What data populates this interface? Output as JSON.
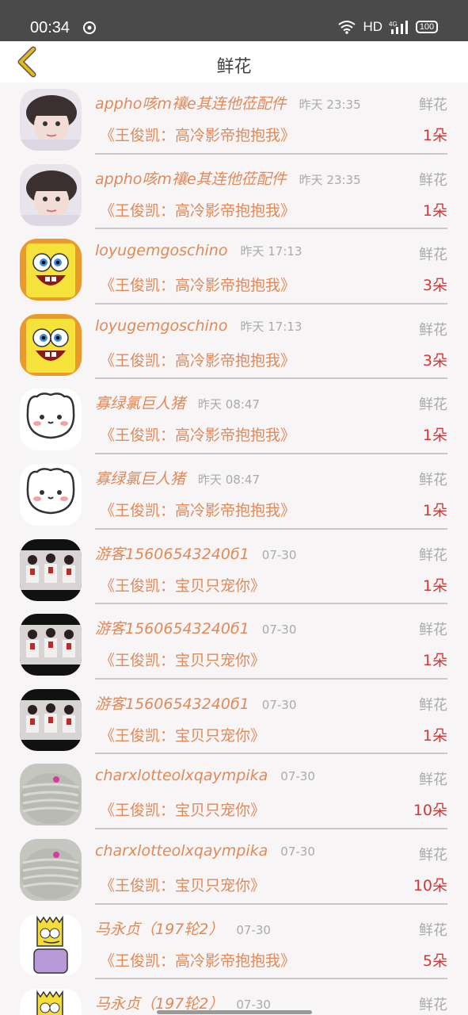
{
  "status": {
    "time": "00:34",
    "network": "HD",
    "signal": "4G",
    "battery": "100"
  },
  "header": {
    "title": "鲜花",
    "back_icon": "chevron-left-icon"
  },
  "colors": {
    "accent": "#e08a5a",
    "count": "#d23a3a",
    "nav_icon": "#e8b818"
  },
  "rows": [
    {
      "avatar": "photo-girl",
      "name": "appho咳m禳e其连他莅配件",
      "time": "昨天 23:35",
      "kind": "鲜花",
      "gift": "《王俊凯：高冷影帝抱抱我》",
      "count": "1朵"
    },
    {
      "avatar": "photo-girl",
      "name": "appho咳m禳e其连他莅配件",
      "time": "昨天 23:35",
      "kind": "鲜花",
      "gift": "《王俊凯：高冷影帝抱抱我》",
      "count": "1朵"
    },
    {
      "avatar": "spongebob",
      "name": "loyugemgoschino",
      "time": "昨天 17:13",
      "kind": "鲜花",
      "gift": "《王俊凯：高冷影帝抱抱我》",
      "count": "3朵"
    },
    {
      "avatar": "spongebob",
      "name": "loyugemgoschino",
      "time": "昨天 17:13",
      "kind": "鲜花",
      "gift": "《王俊凯：高冷影帝抱抱我》",
      "count": "3朵"
    },
    {
      "avatar": "cartoon-cat",
      "name": "寡绿氯巨人猪",
      "time": "昨天 08:47",
      "kind": "鲜花",
      "gift": "《王俊凯：高冷影帝抱抱我》",
      "count": "1朵"
    },
    {
      "avatar": "cartoon-cat",
      "name": "寡绿氯巨人猪",
      "time": "昨天 08:47",
      "kind": "鲜花",
      "gift": "《王俊凯：高冷影帝抱抱我》",
      "count": "1朵"
    },
    {
      "avatar": "group-photo",
      "name": "游客15606543240б1",
      "time": "07-30",
      "kind": "鲜花",
      "gift": "《王俊凯：宝贝只宠你》",
      "count": "1朵"
    },
    {
      "avatar": "group-photo",
      "name": "游客15606543240б1",
      "time": "07-30",
      "kind": "鲜花",
      "gift": "《王俊凯：宝贝只宠你》",
      "count": "1朵"
    },
    {
      "avatar": "group-photo",
      "name": "游客15606543240б1",
      "time": "07-30",
      "kind": "鲜花",
      "gift": "《王俊凯：宝贝只宠你》",
      "count": "1朵"
    },
    {
      "avatar": "knit-texture",
      "name": "charxlotteolxqaympika",
      "time": "07-30",
      "kind": "鲜花",
      "gift": "《王俊凯：宝贝只宠你》",
      "count": "10朵"
    },
    {
      "avatar": "knit-texture",
      "name": "charxlotteolxqaympika",
      "time": "07-30",
      "kind": "鲜花",
      "gift": "《王俊凯：宝贝只宠你》",
      "count": "10朵"
    },
    {
      "avatar": "bart",
      "name": "马永贞（197轮2）",
      "time": "07-30",
      "kind": "鲜花",
      "gift": "《王俊凯：高冷影帝抱抱我》",
      "count": "5朵"
    },
    {
      "avatar": "bart",
      "name": "马永贞（197轮2）",
      "time": "07-30",
      "kind": "鲜花",
      "gift": "",
      "count": ""
    }
  ]
}
